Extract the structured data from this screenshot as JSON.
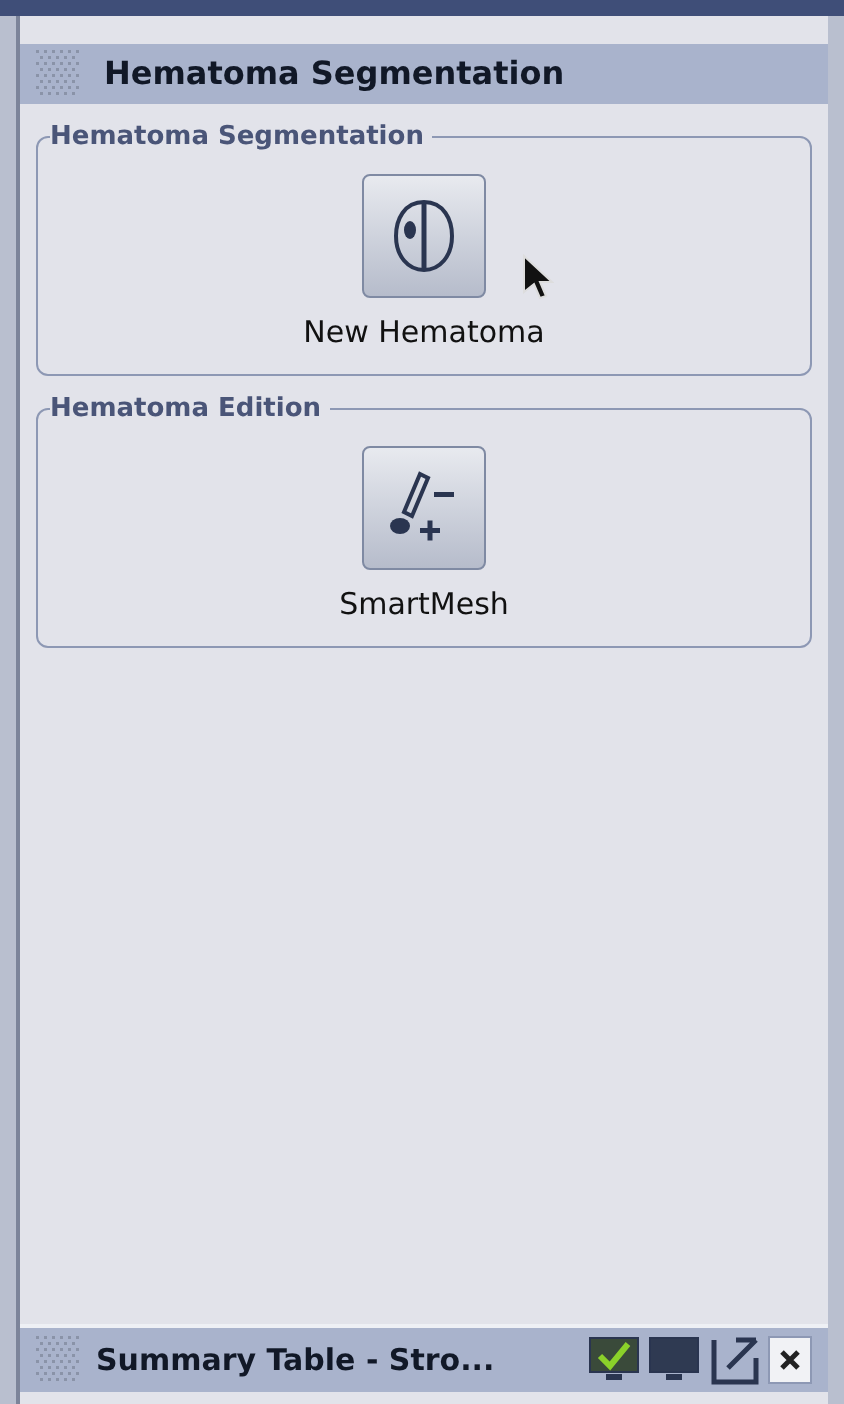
{
  "panel": {
    "title": "Hematoma Segmentation"
  },
  "groups": [
    {
      "title": "Hematoma Segmentation",
      "tool": {
        "kind": "brain",
        "label": "New Hematoma"
      }
    },
    {
      "title": "Hematoma Edition",
      "tool": {
        "kind": "mesh",
        "label": "SmartMesh"
      }
    }
  ],
  "bottom_panel": {
    "title": "Summary Table - Stro...",
    "display_toggles": [
      {
        "checked": true
      },
      {
        "checked": false
      }
    ]
  }
}
